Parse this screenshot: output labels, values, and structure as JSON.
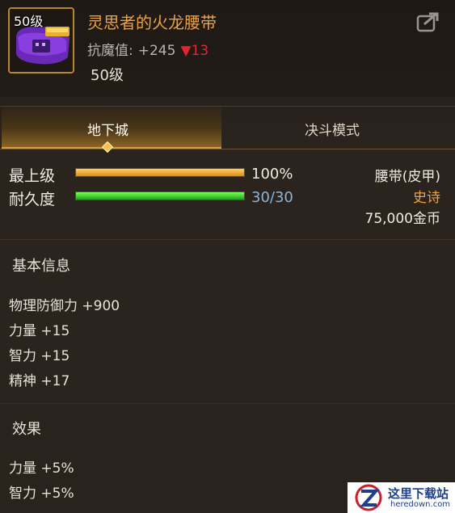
{
  "item": {
    "level_badge": "50级",
    "name": "灵思者的火龙腰带",
    "stat_label": "抗魔值:",
    "stat_value": "+245",
    "stat_diff": "▼13",
    "required_level": "50级",
    "icon": "purple-belt-icon"
  },
  "tabs": [
    {
      "label": "地下城",
      "active": true
    },
    {
      "label": "决斗模式",
      "active": false
    }
  ],
  "bars": {
    "upgrade": {
      "label": "最上级",
      "value_text": "100%",
      "fill": 1.0
    },
    "durability": {
      "label": "耐久度",
      "value_text": "30/30",
      "fill": 1.0
    }
  },
  "info": {
    "type": "腰带(皮甲)",
    "rarity": "史诗",
    "price": "75,000金币"
  },
  "basic_info": {
    "title": "基本信息",
    "attrs": [
      "物理防御力 +900",
      "力量 +15",
      "智力 +15",
      "精神 +17"
    ]
  },
  "effects": {
    "title": "效果",
    "attrs": [
      "力量 +5%",
      "智力 +5%"
    ]
  },
  "watermark": {
    "title": "这里下载站",
    "url": "heredown.com"
  },
  "colors": {
    "name": "#f0a23a",
    "rarity": "#f0a23a",
    "durability_value": "#8ab4d8",
    "down_arrow": "#e0262a",
    "frame": "#b8862e"
  }
}
